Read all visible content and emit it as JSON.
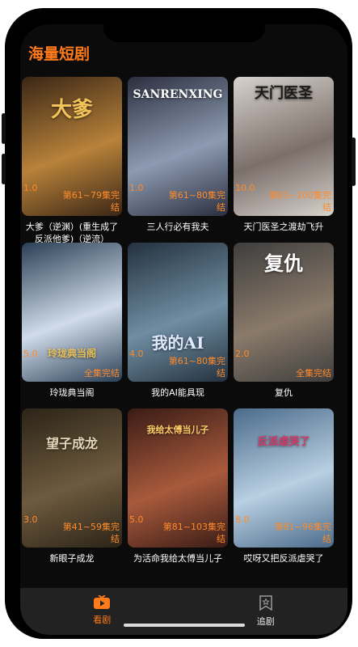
{
  "header": {
    "title": "海量短剧"
  },
  "dramas": [
    {
      "rating": "1.0",
      "status": "第61~79集完结",
      "name": "大爹（逆渊）(重生成了反派他爹)（逆流）",
      "poster_text": "大爹",
      "poster_colors": [
        "#3a2616",
        "#b8823a"
      ]
    },
    {
      "rating": "1.0",
      "status": "第61~80集完结",
      "name": "三人行必有我夫",
      "poster_text": "SANRENXING",
      "poster_colors": [
        "#2b2f3f",
        "#8d9bb2"
      ]
    },
    {
      "rating": "10.0",
      "status": "第81~100集完结",
      "name": "天门医圣之渡劫飞升",
      "poster_text": "天门医圣",
      "poster_colors": [
        "#d7d2cc",
        "#7b6f6a"
      ]
    },
    {
      "rating": "5.0",
      "status": "全集完结",
      "name": "玲珑典当阁",
      "poster_text": "玲珑典当阁",
      "poster_colors": [
        "#2a3f55",
        "#d0dcea"
      ]
    },
    {
      "rating": "4.0",
      "status": "第61~80集完结",
      "name": "我的AI能具现",
      "poster_text": "我的AI",
      "poster_colors": [
        "#24313f",
        "#6f8ea2"
      ]
    },
    {
      "rating": "2.0",
      "status": "全集完结",
      "name": "复仇",
      "poster_text": "复仇",
      "poster_colors": [
        "#3e3e3e",
        "#8a7a6a"
      ]
    },
    {
      "rating": "3.0",
      "status": "第41~59集完结",
      "name": "新眼子成龙",
      "poster_text": "望子成龙",
      "poster_colors": [
        "#2b2418",
        "#6e5a3e"
      ]
    },
    {
      "rating": "5.0",
      "status": "第81~103集完结",
      "name": "为活命我给太傅当儿子",
      "poster_text": "我给太傅当儿子",
      "poster_colors": [
        "#3a1c16",
        "#a85a3c"
      ]
    },
    {
      "rating": "8.0",
      "status": "第81~96集完结",
      "name": "哎呀又把反派虐哭了",
      "poster_text": "反派虐哭了",
      "poster_colors": [
        "#4a6b8a",
        "#b9cfe2"
      ]
    }
  ],
  "tabbar": {
    "tabs": [
      {
        "label": "看剧",
        "icon": "tv-play-icon",
        "active": true
      },
      {
        "label": "追剧",
        "icon": "bookmark-star-icon",
        "active": false
      }
    ]
  },
  "colors": {
    "accent": "#ff7a1a",
    "tab_bg": "#222222",
    "screen_bg": "#0b0b0b"
  }
}
